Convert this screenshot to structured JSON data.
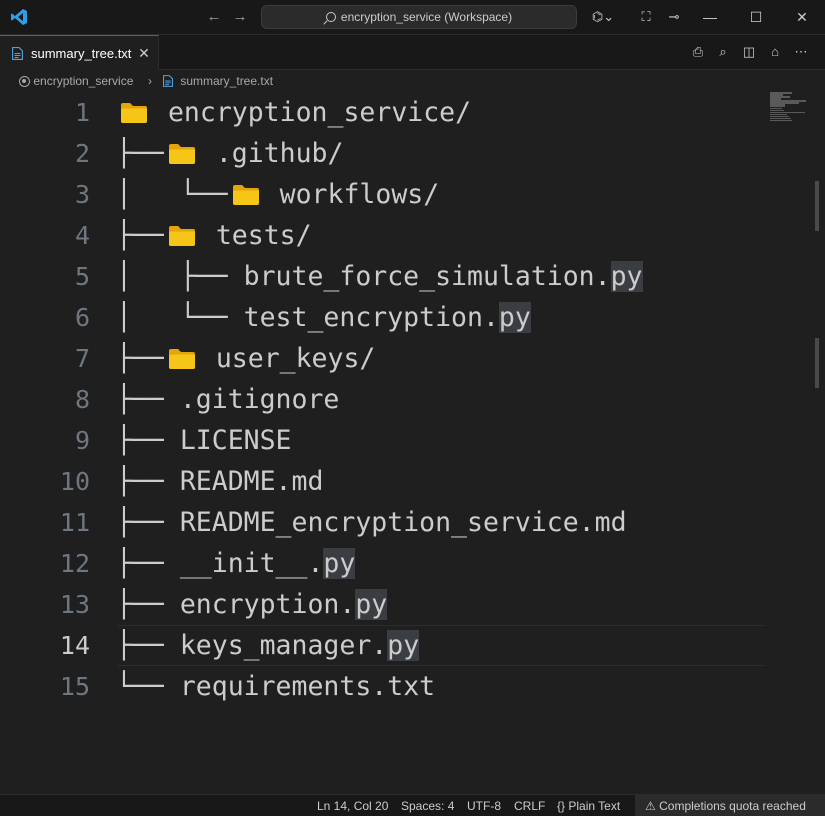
{
  "titlebar": {
    "command_center": "encryption_service (Workspace)",
    "back_glyph": "←",
    "forward_glyph": "→",
    "icons": [
      "vscode-logo-icon",
      "search-icon",
      "copilot-icon",
      "layout-icon",
      "pin-icon"
    ],
    "copilot_glyph": "⌬⌄",
    "layout_glyph": "⛶",
    "pin_glyph": "⊸",
    "minimize_glyph": "—",
    "maximize_glyph": "☐",
    "close_glyph": "✕"
  },
  "tabs": [
    {
      "label": "summary_tree.txt",
      "close_glyph": "✕",
      "active": true
    }
  ],
  "editor_actions": {
    "print_glyph": "⎙",
    "find_glyph": "⌕",
    "split_glyph": "◫",
    "lock_glyph": "⌂",
    "more_glyph": "⋯"
  },
  "breadcrumbs": [
    "encryption_service",
    "summary_tree.txt"
  ],
  "breadcrumb_separator": "›",
  "editor": {
    "current_line": 14,
    "lines": [
      {
        "n": "1",
        "prefix": "",
        "folder": true,
        "text": " encryption_service/",
        "ext": ""
      },
      {
        "n": "2",
        "prefix": "├──",
        "folder": true,
        "text": " .github/",
        "ext": ""
      },
      {
        "n": "3",
        "prefix": "│   └──",
        "folder": true,
        "text": " workflows/",
        "ext": ""
      },
      {
        "n": "4",
        "prefix": "├──",
        "folder": true,
        "text": " tests/",
        "ext": ""
      },
      {
        "n": "5",
        "prefix": "│   ├── ",
        "folder": false,
        "text": "brute_force_simulation.",
        "ext": "py"
      },
      {
        "n": "6",
        "prefix": "│   └── ",
        "folder": false,
        "text": "test_encryption.",
        "ext": "py"
      },
      {
        "n": "7",
        "prefix": "├──",
        "folder": true,
        "text": " user_keys/",
        "ext": ""
      },
      {
        "n": "8",
        "prefix": "├── ",
        "folder": false,
        "text": ".gitignore",
        "ext": ""
      },
      {
        "n": "9",
        "prefix": "├── ",
        "folder": false,
        "text": "LICENSE",
        "ext": ""
      },
      {
        "n": "10",
        "prefix": "├── ",
        "folder": false,
        "text": "README.md",
        "ext": ""
      },
      {
        "n": "11",
        "prefix": "├── ",
        "folder": false,
        "text": "README_encryption_service.md",
        "ext": ""
      },
      {
        "n": "12",
        "prefix": "├── ",
        "folder": false,
        "text": "__init__.",
        "ext": "py"
      },
      {
        "n": "13",
        "prefix": "├── ",
        "folder": false,
        "text": "encryption.",
        "ext": "py"
      },
      {
        "n": "14",
        "prefix": "├── ",
        "folder": false,
        "text": "keys_manager.",
        "ext": "py"
      },
      {
        "n": "15",
        "prefix": "└── ",
        "folder": false,
        "text": "requirements.txt",
        "ext": ""
      }
    ]
  },
  "statusbar": {
    "position": "Ln 14, Col 20",
    "indent": "Spaces: 4",
    "encoding": "UTF-8",
    "eol": "CRLF",
    "language": "Plain Text",
    "language_glyph": "{}",
    "quota": "Completions quota reached",
    "quota_glyph": "⚠"
  },
  "colors": {
    "accent": "#0078d4",
    "folder": "#f5c518",
    "background": "#1f1f1f"
  }
}
